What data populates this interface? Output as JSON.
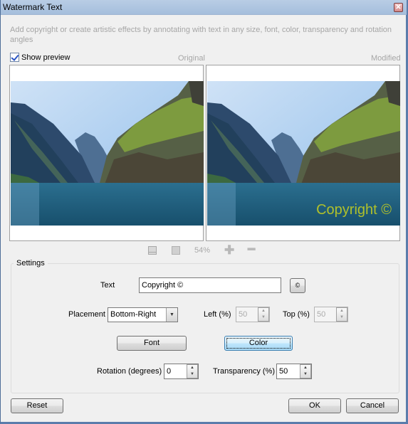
{
  "window": {
    "title": "Watermark Text",
    "close_label": "✕"
  },
  "description": "Add copyright or create artistic effects by annotating with text in any size, font, color, transparency and rotation angles",
  "preview": {
    "show_preview_label": "Show preview",
    "show_preview_checked": true,
    "original_caption": "Original",
    "modified_caption": "Modified",
    "watermark_text": "Copyright ©",
    "watermark_color": "#c9d21e"
  },
  "zoom_bar": {
    "fit_icon": "fit-to-window-icon",
    "actual_icon": "actual-size-icon",
    "zoom_level": "54%",
    "zoom_in_icon": "zoom-in-icon",
    "zoom_out_icon": "zoom-out-icon"
  },
  "settings": {
    "group_label": "Settings",
    "text_label": "Text",
    "text_value": "Copyright ©",
    "copyright_symbol_button": "©",
    "placement_label": "Placement",
    "placement_value": "Bottom-Right",
    "left_label": "Left (%)",
    "left_value": "50",
    "top_label": "Top (%)",
    "top_value": "50",
    "font_button": "Font",
    "color_button": "Color",
    "rotation_label": "Rotation (degrees)",
    "rotation_value": "0",
    "transparency_label": "Transparency (%)",
    "transparency_value": "50"
  },
  "footer": {
    "reset_button": "Reset",
    "ok_button": "OK",
    "cancel_button": "Cancel"
  }
}
